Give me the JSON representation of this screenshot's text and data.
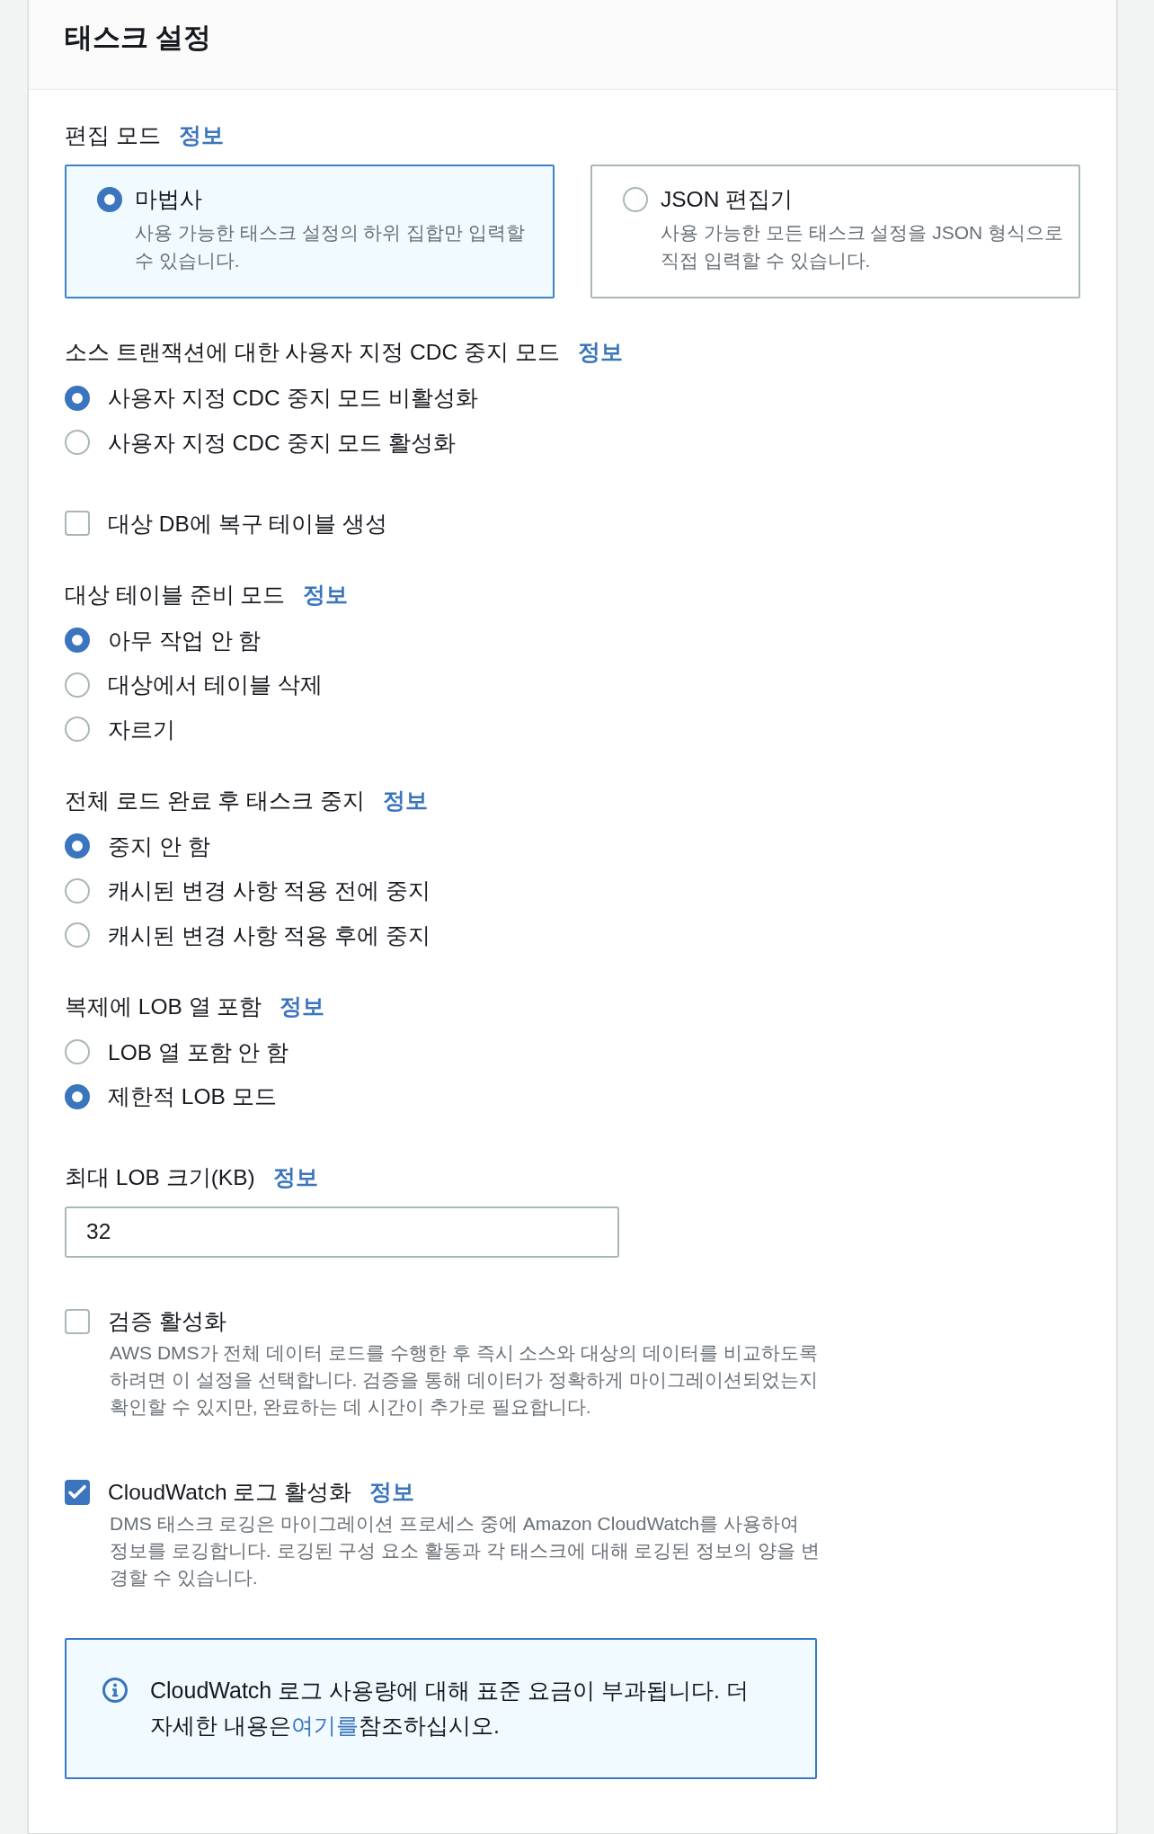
{
  "panel": {
    "title": "태스크 설정"
  },
  "fields": [
    {
      "kind": "tiles",
      "label": "편집 모드",
      "info": "정보",
      "options": [
        {
          "title": "마법사",
          "description": "사용 가능한 태스크 설정의 하위 집합만 입력할 수 있습니다.",
          "selected": true
        },
        {
          "title": "JSON 편집기",
          "description": "사용 가능한 모든 태스크 설정을 JSON 형식으로 직접 입력할 수 있습니다.",
          "selected": false
        }
      ]
    },
    {
      "kind": "radio",
      "label": "소스 트랜잭션에 대한 사용자 지정 CDC 중지 모드",
      "info": "정보",
      "options": [
        {
          "label": "사용자 지정 CDC 중지 모드 비활성화",
          "selected": true
        },
        {
          "label": "사용자 지정 CDC 중지 모드 활성화",
          "selected": false
        }
      ]
    },
    {
      "kind": "checkbox",
      "label": "대상 DB에 복구 테이블 생성",
      "checked": false
    },
    {
      "kind": "radio",
      "label": "대상 테이블 준비 모드",
      "info": "정보",
      "options": [
        {
          "label": "아무 작업 안 함",
          "selected": true
        },
        {
          "label": "대상에서 테이블 삭제",
          "selected": false
        },
        {
          "label": "자르기",
          "selected": false
        }
      ]
    },
    {
      "kind": "radio",
      "label": "전체 로드 완료 후 태스크 중지",
      "info": "정보",
      "options": [
        {
          "label": "중지 안 함",
          "selected": true
        },
        {
          "label": "캐시된 변경 사항 적용 전에 중지",
          "selected": false
        },
        {
          "label": "캐시된 변경 사항 적용 후에 중지",
          "selected": false
        }
      ]
    },
    {
      "kind": "radio",
      "label": "복제에 LOB 열 포함",
      "info": "정보",
      "options": [
        {
          "label": "LOB 열 포함 안 함",
          "selected": false
        },
        {
          "label": "제한적 LOB 모드",
          "selected": true
        }
      ]
    },
    {
      "kind": "input",
      "label": "최대 LOB 크기(KB)",
      "info": "정보",
      "value": "32"
    },
    {
      "kind": "checkbox",
      "label": "검증 활성화",
      "checked": false,
      "description": "AWS DMS가 전체 데이터 로드를 수행한 후 즉시 소스와 대상의 데이터를 비교하도록 하려면 이 설정을 선택합니다. 검증을 통해 데이터가 정확하게 마이그레이션되었는지 확인할 수 있지만, 완료하는 데 시간이 추가로 필요합니다."
    },
    {
      "kind": "checkbox",
      "label": "CloudWatch 로그 활성화",
      "info": "정보",
      "checked": true,
      "description": "DMS 태스크 로깅은 마이그레이션 프로세스 중에 Amazon CloudWatch를 사용하여 정보를 로깅합니다. 로깅된 구성 요소 활동과 각 태스크에 대해 로깅된 정보의 양을 변경할 수 있습니다."
    },
    {
      "kind": "alert",
      "text": "CloudWatch 로그 사용량에 대해 표준 요금이 부과됩니다. 더 자세한 내용은",
      "link": "여기를",
      "text_after": "참조하십시오."
    }
  ]
}
